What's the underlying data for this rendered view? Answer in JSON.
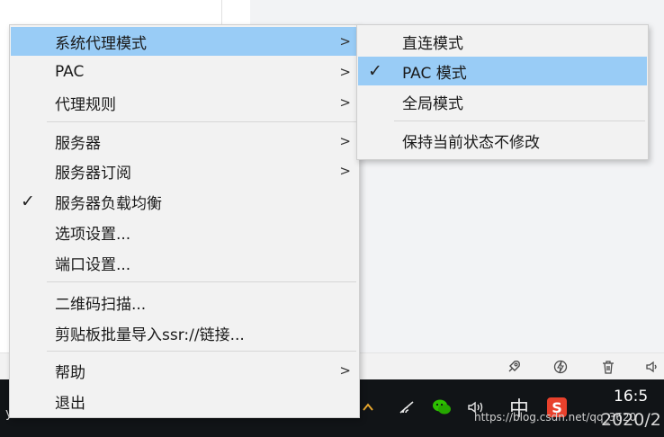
{
  "menu": {
    "items": [
      {
        "label": "系统代理模式",
        "has_submenu": true,
        "checked": false,
        "highlighted": true
      },
      {
        "label": "PAC",
        "has_submenu": true,
        "checked": false,
        "highlighted": false
      },
      {
        "label": "代理规则",
        "has_submenu": true,
        "checked": false,
        "highlighted": false
      },
      {
        "label": "服务器",
        "has_submenu": true,
        "checked": false,
        "highlighted": false
      },
      {
        "label": "服务器订阅",
        "has_submenu": true,
        "checked": false,
        "highlighted": false
      },
      {
        "label": "服务器负载均衡",
        "has_submenu": false,
        "checked": true,
        "highlighted": false
      },
      {
        "label": "选项设置...",
        "has_submenu": false,
        "checked": false,
        "highlighted": false
      },
      {
        "label": "端口设置...",
        "has_submenu": false,
        "checked": false,
        "highlighted": false
      },
      {
        "label": "二维码扫描...",
        "has_submenu": false,
        "checked": false,
        "highlighted": false
      },
      {
        "label": "剪贴板批量导入ssr://链接...",
        "has_submenu": false,
        "checked": false,
        "highlighted": false
      },
      {
        "label": "帮助",
        "has_submenu": true,
        "checked": false,
        "highlighted": false
      },
      {
        "label": "退出",
        "has_submenu": false,
        "checked": false,
        "highlighted": false
      }
    ],
    "arrow_glyph": ">",
    "check_glyph": "✓"
  },
  "submenu": {
    "items": [
      {
        "label": "直连模式",
        "checked": false,
        "highlighted": false
      },
      {
        "label": "PAC 模式",
        "checked": true,
        "highlighted": true
      },
      {
        "label": "全局模式",
        "checked": false,
        "highlighted": false
      },
      {
        "label": "保持当前状态不修改",
        "checked": false,
        "highlighted": false
      }
    ]
  },
  "taskbar": {
    "time": "16:5",
    "date": "2020/2",
    "ime": "中",
    "sogou": "S",
    "watermark": "https://blog.csdn.net/qq_3620",
    "dot": "y."
  },
  "colors": {
    "highlight": "#99ccf6",
    "menu_bg": "#f2f2f2",
    "taskbar_bg": "#111417"
  },
  "icons": {
    "action_bar": [
      "rocket-icon",
      "lightning-circle-icon",
      "trash-icon",
      "speaker-icon"
    ],
    "tray": [
      "chevron-up-icon",
      "wifi-icon",
      "wechat-icon",
      "volume-icon"
    ]
  }
}
